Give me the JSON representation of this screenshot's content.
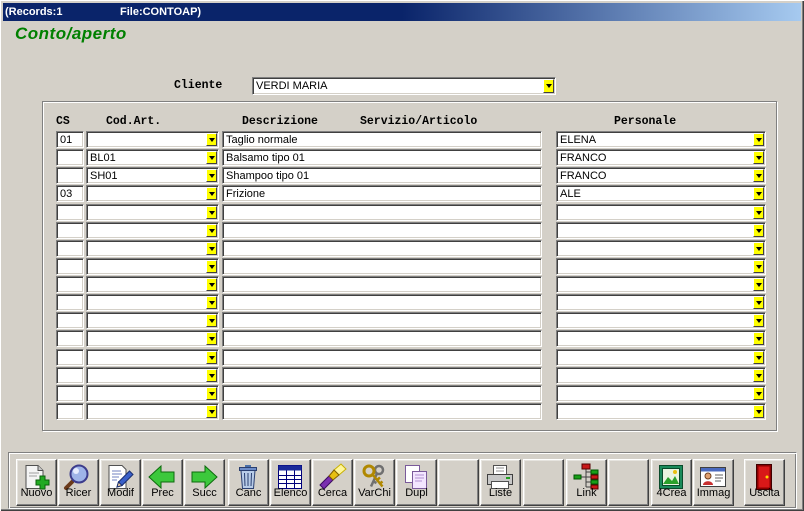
{
  "window": {
    "records": "(Records:1",
    "file": "File:CONTOAP)"
  },
  "form": {
    "title": "Conto/aperto",
    "cliente": {
      "label": "Cliente",
      "value": "VERDI MARIA"
    }
  },
  "grid": {
    "headers": {
      "cs": "CS",
      "cod_art": "Cod.Art.",
      "descrizione": "Descrizione",
      "servizio_articolo": "Servizio/Articolo",
      "personale": "Personale"
    },
    "rows": [
      {
        "cs": "01",
        "cod_art": "",
        "descrizione": "Taglio normale",
        "personale": "ELENA"
      },
      {
        "cs": "",
        "cod_art": "BL01",
        "descrizione": "Balsamo tipo 01",
        "personale": "FRANCO"
      },
      {
        "cs": "",
        "cod_art": "SH01",
        "descrizione": "Shampoo tipo 01",
        "personale": "FRANCO"
      },
      {
        "cs": "03",
        "cod_art": "",
        "descrizione": "Frizione",
        "personale": "ALE"
      },
      {
        "cs": "",
        "cod_art": "",
        "descrizione": "",
        "personale": ""
      },
      {
        "cs": "",
        "cod_art": "",
        "descrizione": "",
        "personale": ""
      },
      {
        "cs": "",
        "cod_art": "",
        "descrizione": "",
        "personale": ""
      },
      {
        "cs": "",
        "cod_art": "",
        "descrizione": "",
        "personale": ""
      },
      {
        "cs": "",
        "cod_art": "",
        "descrizione": "",
        "personale": ""
      },
      {
        "cs": "",
        "cod_art": "",
        "descrizione": "",
        "personale": ""
      },
      {
        "cs": "",
        "cod_art": "",
        "descrizione": "",
        "personale": ""
      },
      {
        "cs": "",
        "cod_art": "",
        "descrizione": "",
        "personale": ""
      },
      {
        "cs": "",
        "cod_art": "",
        "descrizione": "",
        "personale": ""
      },
      {
        "cs": "",
        "cod_art": "",
        "descrizione": "",
        "personale": ""
      },
      {
        "cs": "",
        "cod_art": "",
        "descrizione": "",
        "personale": ""
      },
      {
        "cs": "",
        "cod_art": "",
        "descrizione": "",
        "personale": ""
      }
    ]
  },
  "toolbar": {
    "buttons": [
      {
        "label": "Nuovo",
        "icon": "new-document-icon"
      },
      {
        "label": "Ricer",
        "icon": "magnifier-icon"
      },
      {
        "label": "Modif",
        "icon": "edit-document-icon"
      },
      {
        "label": "Prec",
        "icon": "arrow-left-icon"
      },
      {
        "label": "Succ",
        "icon": "arrow-right-icon"
      },
      {
        "label": "Canc",
        "icon": "trash-icon"
      },
      {
        "label": "Elenco",
        "icon": "table-icon"
      },
      {
        "label": "Cerca",
        "icon": "flashlight-icon"
      },
      {
        "label": "VarChi",
        "icon": "keys-icon"
      },
      {
        "label": "Dupl",
        "icon": "duplicate-icon"
      },
      {
        "label": "Liste",
        "icon": "printer-icon"
      },
      {
        "label": "Link",
        "icon": "link-tree-icon"
      },
      {
        "label": "4Crea",
        "icon": "picture-frame-icon"
      },
      {
        "label": "Immag",
        "icon": "id-card-icon"
      },
      {
        "label": "Uscita",
        "icon": "exit-door-icon"
      }
    ]
  },
  "colors": {
    "window_background": "#d4d0c8",
    "title_bar": "#0a246a",
    "heading": "#008000",
    "dropdown_button": "#ffff00",
    "field_background": "#ffffff"
  }
}
